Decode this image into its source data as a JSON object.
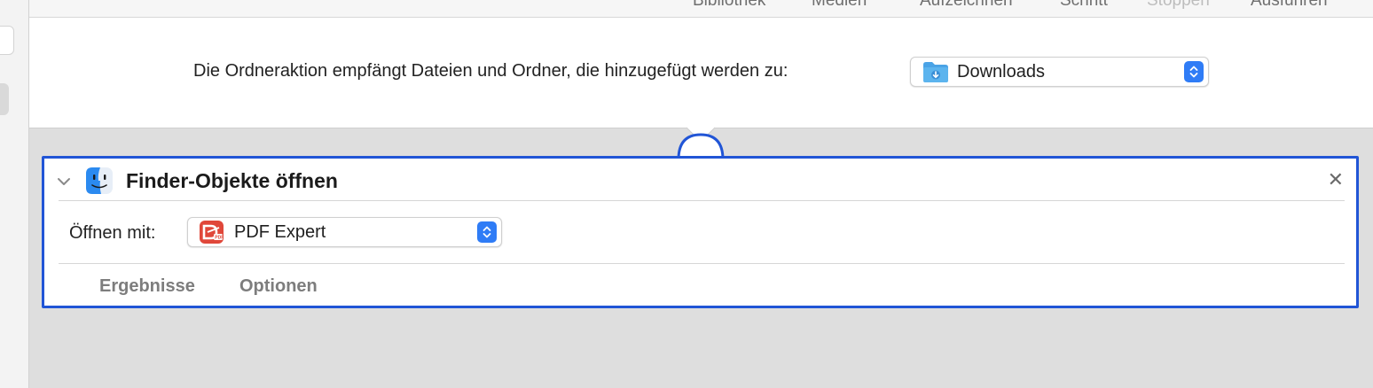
{
  "toolbar": {
    "items": [
      "Bibliothek",
      "Medien",
      "Aufzeichnen",
      "Schritt",
      "Stoppen",
      "Ausführen"
    ]
  },
  "header": {
    "label": "Die Ordneraktion empfängt Dateien und Ordner, die hinzugefügt werden zu:",
    "folder_popup": {
      "selected": "Downloads",
      "icon": "downloads-folder-icon"
    }
  },
  "action": {
    "title": "Finder-Objekte öffnen",
    "icon": "finder-icon",
    "close_icon": "close-icon",
    "open_with_label": "Öffnen mit:",
    "app_popup": {
      "selected": "PDF Expert",
      "icon": "pdf-expert-icon"
    },
    "tabs": [
      "Ergebnisse",
      "Optionen"
    ]
  },
  "colors": {
    "accent": "#2f7cf6",
    "card_border": "#2155d6",
    "workflow_background": "#dedede"
  }
}
